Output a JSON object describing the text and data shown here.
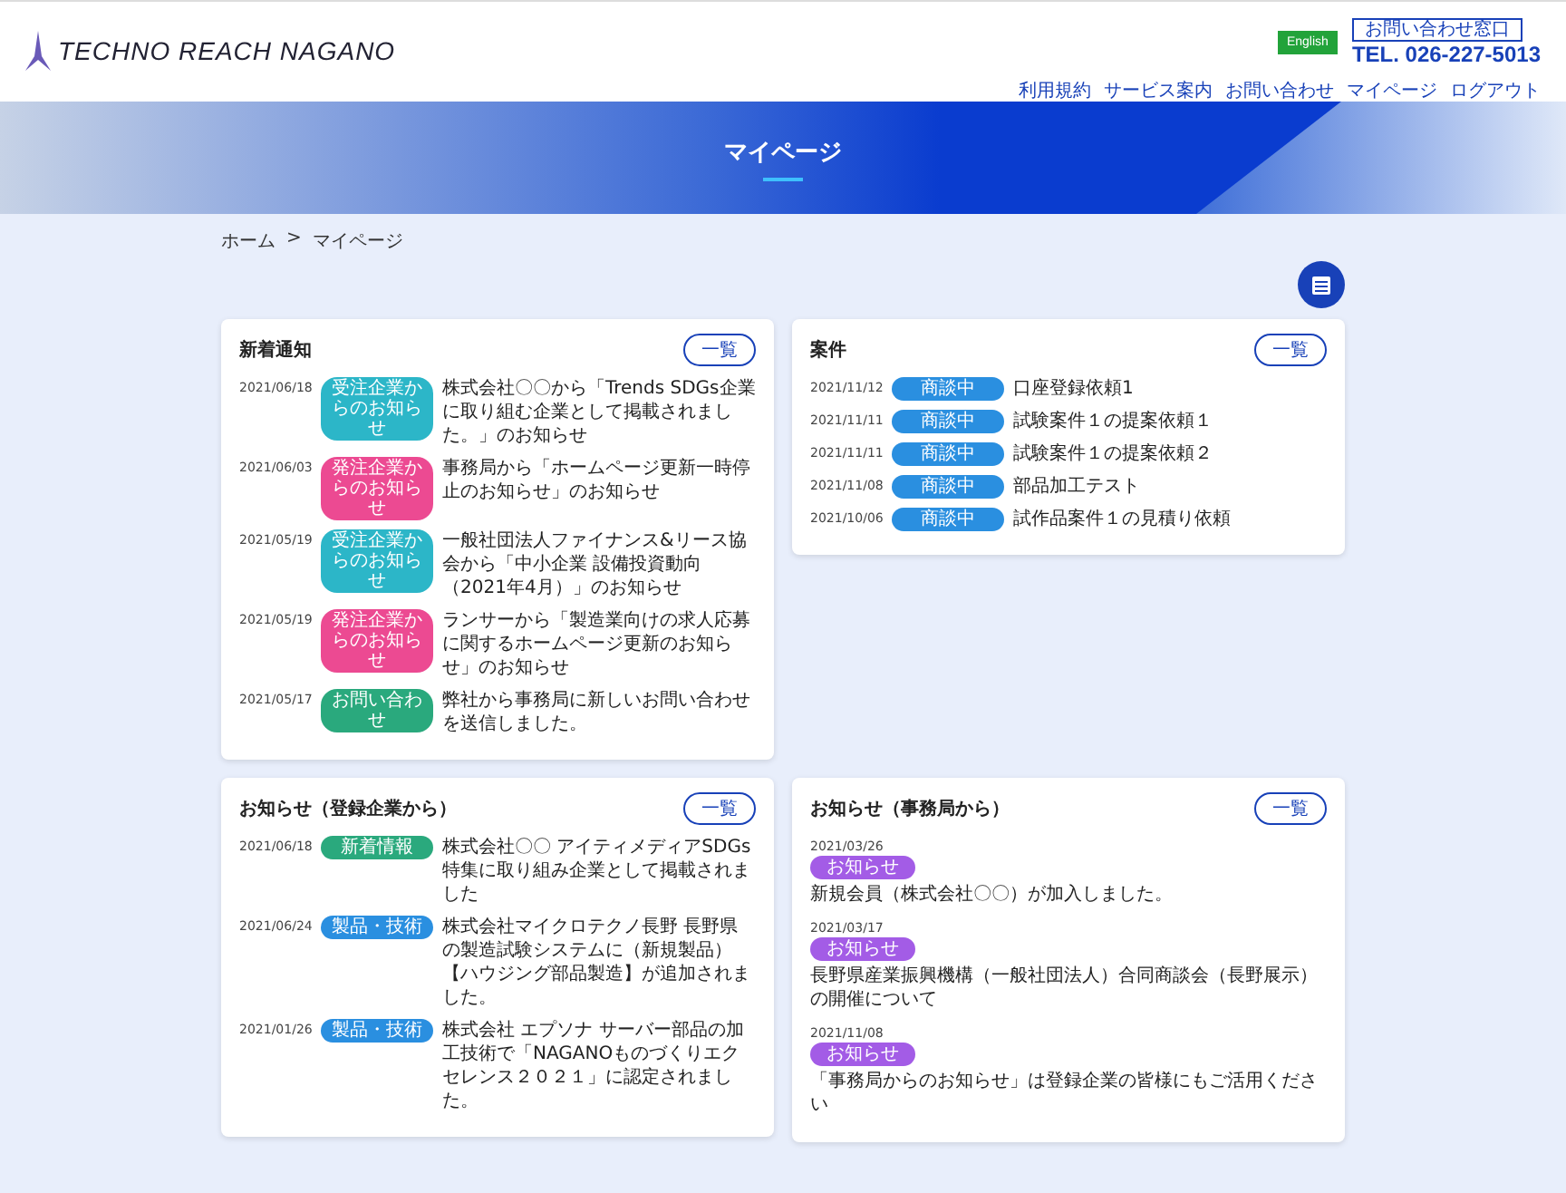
{
  "header": {
    "logo": "TECHNO REACH NAGANO",
    "language_button": "English",
    "contact_label": "お問い合わせ窓口",
    "phone": "TEL. 026-227-5013",
    "nav": [
      "利用規約",
      "サービス案内",
      "お問い合わせ",
      "マイページ",
      "ログアウト"
    ]
  },
  "hero": {
    "title": "マイページ"
  },
  "breadcrumb": {
    "items": [
      "ホーム",
      "マイページ"
    ],
    "separator": ">"
  },
  "panels": [
    {
      "title": "新着通知",
      "button": "一覧",
      "kind": "inline",
      "items": [
        {
          "date": "2021/06/18",
          "tag": "受注企業からのお知らせ",
          "color": "#2cb6c8",
          "text": "株式会社〇〇から「Trends SDGs企業に取り組む企業として掲載されました。」のお知らせ"
        },
        {
          "date": "2021/06/03",
          "tag": "発注企業からのお知らせ",
          "color": "#ec4a92",
          "text": "事務局から「ホームページ更新一時停止のお知らせ」のお知らせ"
        },
        {
          "date": "2021/05/19",
          "tag": "受注企業からのお知らせ",
          "color": "#2cb6c8",
          "text": "一般社団法人ファイナンス&リース協会から「中小企業 設備投資動向（2021年4月）」のお知らせ"
        },
        {
          "date": "2021/05/19",
          "tag": "発注企業からのお知らせ",
          "color": "#ec4a92",
          "text": "ランサーから「製造業向けの求人応募に関するホームページ更新のお知らせ」のお知らせ"
        },
        {
          "date": "2021/05/17",
          "tag": "お問い合わせ",
          "color": "#2aa97d",
          "text": "弊社から事務局に新しいお問い合わせを送信しました。"
        }
      ]
    },
    {
      "title": "案件",
      "button": "一覧",
      "kind": "inline",
      "items": [
        {
          "date": "2021/11/12",
          "tag": "商談中",
          "color": "#2a8fe0",
          "text": "口座登録依頼1"
        },
        {
          "date": "2021/11/11",
          "tag": "商談中",
          "color": "#2a8fe0",
          "text": "試験案件１の提案依頼１"
        },
        {
          "date": "2021/11/11",
          "tag": "商談中",
          "color": "#2a8fe0",
          "text": "試験案件１の提案依頼２"
        },
        {
          "date": "2021/11/08",
          "tag": "商談中",
          "color": "#2a8fe0",
          "text": "部品加工テスト"
        },
        {
          "date": "2021/10/06",
          "tag": "商談中",
          "color": "#2a8fe0",
          "text": "試作品案件１の見積り依頼"
        }
      ]
    },
    {
      "title": "お知らせ（登録企業から）",
      "button": "一覧",
      "kind": "inline",
      "items": [
        {
          "date": "2021/06/18",
          "tag": "新着情報",
          "color": "#2aa97d",
          "text": "株式会社〇〇 アイティメディアSDGs特集に取り組み企業として掲載されました"
        },
        {
          "date": "2021/06/24",
          "tag": "製品・技術",
          "color": "#2a8fe0",
          "text": "株式会社マイクロテクノ長野 長野県の製造試験システムに（新規製品）【ハウジング部品製造】が追加されました。"
        },
        {
          "date": "2021/01/26",
          "tag": "製品・技術",
          "color": "#2a8fe0",
          "text": "株式会社 エプソナ サーバー部品の加工技術で「NAGANOものづくりエクセレンス２０２１」に認定されました。"
        }
      ]
    },
    {
      "title": "お知らせ（事務局から）",
      "button": "一覧",
      "kind": "stacked",
      "items": [
        {
          "date": "2021/03/26",
          "tag": "お知らせ",
          "color": "#a35ce6",
          "text": "新規会員（株式会社〇〇）が加入しました。"
        },
        {
          "date": "2021/03/17",
          "tag": "お知らせ",
          "color": "#a35ce6",
          "text": "長野県産業振興機構（一般社団法人）合同商談会（長野展示）の開催について"
        },
        {
          "date": "2021/11/08",
          "tag": "お知らせ",
          "color": "#a35ce6",
          "text": "「事務局からのお知らせ」は登録企業の皆様にもご活用ください"
        }
      ]
    }
  ]
}
